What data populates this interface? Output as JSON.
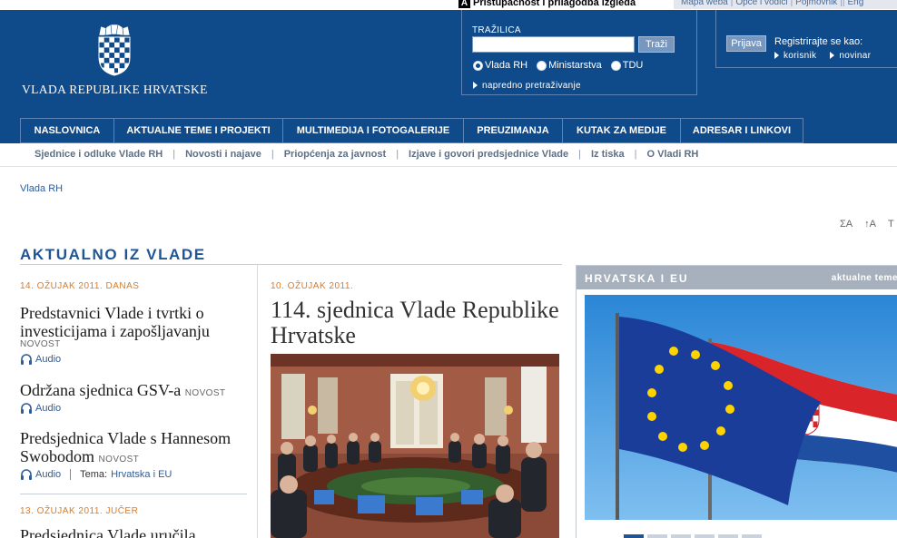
{
  "top": {
    "accessibility_label": "Pristupačnost i prilagodba izgleda",
    "accessibility_icon": "A",
    "utility_links": [
      "Mapa weba",
      "Opće i vodiči",
      "Pojmovnik",
      "Eng"
    ]
  },
  "header": {
    "site_name": "VLADA REPUBLIKE HRVATSKE",
    "search": {
      "title": "TRAŽILICA",
      "value": "",
      "button": "Traži",
      "radios": [
        {
          "label": "Vlada RH",
          "checked": true
        },
        {
          "label": "Ministarstva",
          "checked": false
        },
        {
          "label": "TDU",
          "checked": false
        }
      ],
      "advanced": "napredno pretraživanje"
    },
    "login": {
      "button": "Prijava",
      "register_text": "Registrirajte se kao:",
      "options": [
        "korisnik",
        "novinar"
      ]
    }
  },
  "nav": {
    "main": [
      "NASLOVNICA",
      "AKTUALNE TEME I PROJEKTI",
      "MULTIMEDIJA I FOTOGALERIJE",
      "PREUZIMANJA",
      "KUTAK ZA MEDIJE",
      "ADRESAR I LINKOVI"
    ],
    "sub": [
      "Sjednice i odluke Vlade RH",
      "Novosti i najave",
      "Priopćenja za javnost",
      "Izjave i govori predsjednice Vlade",
      "Iz tiska",
      "O Vladi RH"
    ]
  },
  "breadcrumb": "Vlada RH",
  "font_controls": [
    "ΣA",
    "↑A",
    "T"
  ],
  "content": {
    "section_title": "AKTUALNO IZ VLADE",
    "date_1": "14. OŽUJAK 2011. DANAS",
    "news": [
      {
        "title": "Predstavnici Vlade i tvrtki o investicijama i zapošljavanju",
        "tag": "NOVOST",
        "audio": "Audio"
      },
      {
        "title": "Održana sjednica GSV-a",
        "tag": "NOVOST",
        "audio": "Audio"
      },
      {
        "title": "Predsjednica Vlade s Hannesom Swobodom",
        "tag": "NOVOST",
        "audio": "Audio",
        "tema_label": "Tema:",
        "tema_value": "Hrvatska i EU"
      }
    ],
    "date_2": "13. OŽUJAK 2011. JUČER",
    "news_4_title": "Predsjednica Vlade uručila",
    "featured": {
      "date": "10. OŽUJAK 2011.",
      "title": "114. sjednica Vlade Republike Hrvatske"
    }
  },
  "eu": {
    "title": "HRVATSKA I EU",
    "link": "aktualne teme"
  },
  "colors": {
    "header_blue": "#0f4a8a",
    "accent_orange": "#e07a1f",
    "link_blue": "#2d5d9b",
    "panel_grey": "#a7b1bd"
  }
}
